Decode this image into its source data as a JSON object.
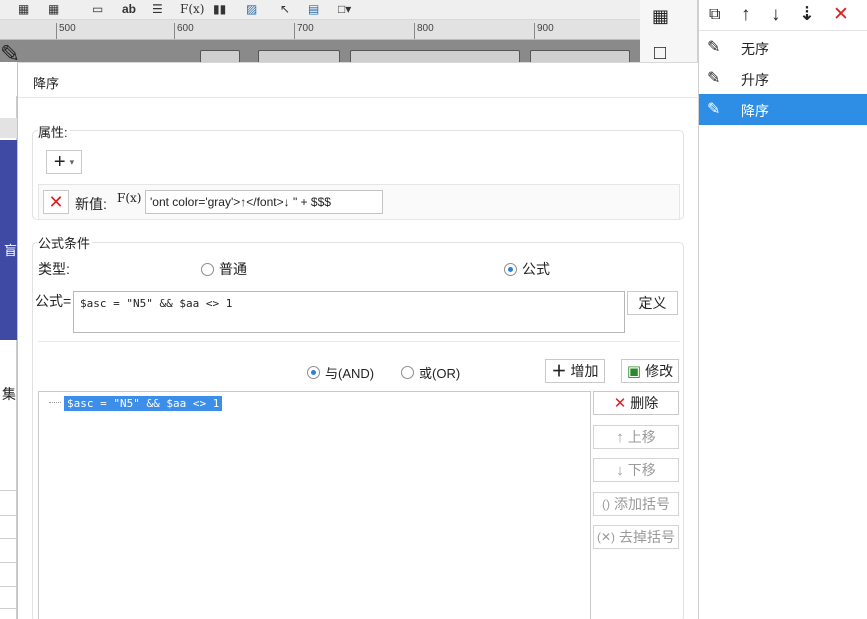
{
  "ruler": {
    "ticks": [
      "500",
      "600",
      "700",
      "800",
      "900"
    ]
  },
  "toolbar_icons": [
    "grid-icon",
    "table-icon",
    "textbox-icon",
    "text-ab-icon",
    "align-icon",
    "formula-icon",
    "bar-chart-icon",
    "image-icon",
    "pointer-icon",
    "document-icon",
    "cell-icon"
  ],
  "toolbar_text": {
    "ab": "ab",
    "fx": "F(x)"
  },
  "right_panel": {
    "items": [
      {
        "label": "无序",
        "selected": false
      },
      {
        "label": "升序",
        "selected": false
      },
      {
        "label": "降序",
        "selected": true
      }
    ]
  },
  "left_edge": {
    "chars": [
      "集",
      "盲"
    ]
  },
  "dialog": {
    "title": "降序",
    "attributes": {
      "legend": "属性:",
      "add_glyph": "+",
      "value_label": "新值:",
      "fx_glyph": "F(x)",
      "value_text": "'ont color='gray'>↑</font>↓ \" + $$$"
    },
    "formula_condition": {
      "legend": "公式条件",
      "type_label": "类型:",
      "radio_normal": "普通",
      "radio_formula": "公式",
      "formula_label": "公式=",
      "formula_text": "$asc = \"N5\" && $aa <> 1",
      "define_button": "定义",
      "and_label": "与(AND)",
      "or_label": "或(OR)",
      "add_button": "增加",
      "modify_button": "修改",
      "conditions": [
        "$asc = \"N5\" && $aa <> 1"
      ],
      "delete_button": "删除",
      "move_up_button": "上移",
      "move_down_button": "下移",
      "add_bracket_button": "添加括号",
      "remove_bracket_button": "去掉括号"
    }
  },
  "colors": {
    "accent": "#2e8ee6",
    "selection": "#3d8ee8",
    "danger": "#e02020",
    "navy": "#3f4aa5"
  }
}
